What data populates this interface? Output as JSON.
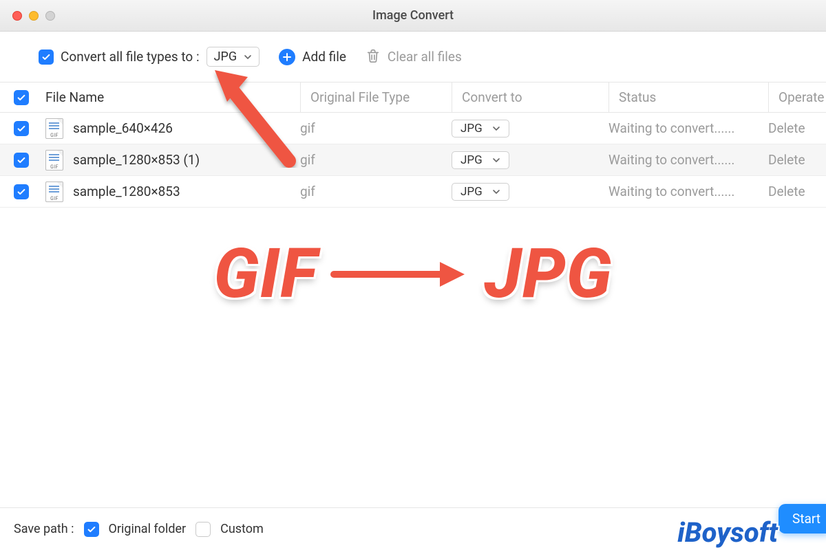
{
  "window": {
    "title": "Image Convert"
  },
  "toolbar": {
    "convert_all_label": "Convert all file types to :",
    "format_selected": "JPG",
    "add_file_label": "Add file",
    "clear_all_label": "Clear all files"
  },
  "columns": {
    "file_name": "File Name",
    "original_type": "Original File Type",
    "convert_to": "Convert to",
    "status": "Status",
    "operate": "Operate"
  },
  "rows": [
    {
      "name": "sample_640×426",
      "orig": "gif",
      "to": "JPG",
      "status": "Waiting to convert......",
      "op": "Delete"
    },
    {
      "name": "sample_1280×853 (1)",
      "orig": "gif",
      "to": "JPG",
      "status": "Waiting to convert......",
      "op": "Delete"
    },
    {
      "name": "sample_1280×853",
      "orig": "gif",
      "to": "JPG",
      "status": "Waiting to convert......",
      "op": "Delete"
    }
  ],
  "file_icon_tag": "GIF",
  "bottom": {
    "save_path_label": "Save path :",
    "original_folder": "Original folder",
    "custom": "Custom",
    "start": "Start"
  },
  "annotation": {
    "from": "GIF",
    "to": "JPG"
  },
  "watermark": "iBoysoft",
  "colors": {
    "accent": "#1f7dff",
    "annotation": "#ef5542"
  }
}
